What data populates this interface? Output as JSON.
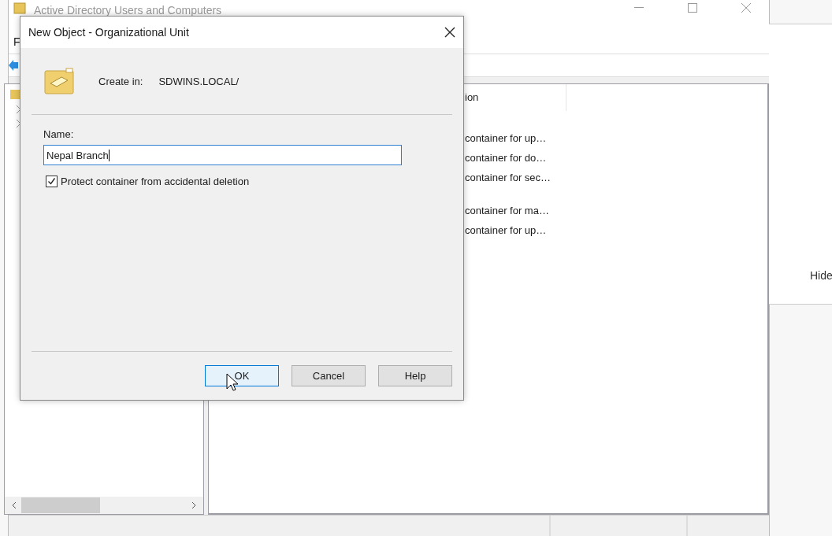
{
  "background_window": {
    "title": "Active Directory Users and Computers",
    "menu": [
      "F"
    ],
    "list": {
      "columns": [
        "ion"
      ],
      "row_groups": [
        [
          "container for up…",
          "container for do…",
          "container for sec…"
        ],
        [
          "container for ma…",
          "container for up…"
        ]
      ]
    }
  },
  "side_panel": {
    "link": "Hide"
  },
  "dialog": {
    "title": "New Object - Organizational Unit",
    "create_in_label": "Create in:",
    "create_in_value": "SDWINS.LOCAL/",
    "name_label": "Name:",
    "name_value": "Nepal Branch",
    "protect": {
      "label": "Protect container from accidental deletion",
      "checked": true
    },
    "buttons": [
      {
        "label": "OK",
        "focused": true
      },
      {
        "label": "Cancel",
        "focused": false
      },
      {
        "label": "Help",
        "focused": false
      }
    ]
  }
}
